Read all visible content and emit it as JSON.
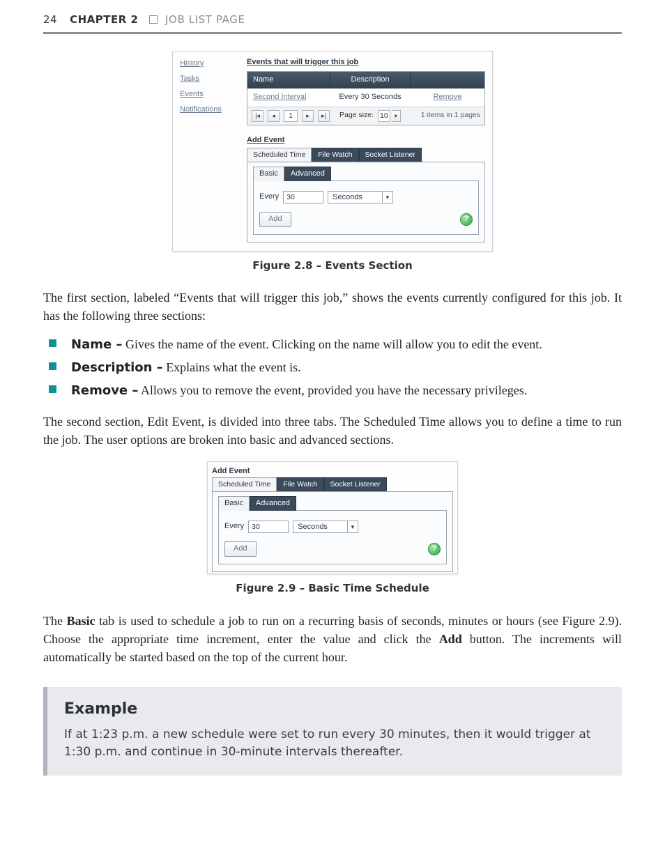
{
  "header": {
    "page_number": "24",
    "chapter_label": "CHAPTER 2",
    "section_title": "JOB LIST PAGE"
  },
  "fig28": {
    "sidebar": [
      "History",
      "Tasks",
      "Events",
      "Notifications"
    ],
    "section_title": "Events that will trigger this job",
    "cols": {
      "name": "Name",
      "desc": "Description"
    },
    "row": {
      "name": "Second Interval",
      "desc": "Every 30 Seconds",
      "remove": "Remove"
    },
    "pager": {
      "first": "|◂",
      "prev": "◂",
      "page": "1",
      "next": "▸",
      "last": "▸|",
      "size_label": "Page size:",
      "size_value": "10",
      "info": "1 items in 1 pages"
    },
    "addevent": {
      "title": "Add Event",
      "tabs": [
        "Scheduled Time",
        "File Watch",
        "Socket Listener"
      ],
      "inner_tabs": [
        "Basic",
        "Advanced"
      ],
      "every_label": "Every",
      "every_value": "30",
      "unit": "Seconds",
      "add_label": "Add"
    },
    "caption": "Figure 2.8 – Events Section"
  },
  "para1": "The first section, labeled “Events that will trigger this job,” shows the events currently configured for this job. It has the following three sections:",
  "bullets": [
    {
      "term": "Name –",
      "text": " Gives the name of the event. Clicking on the name will allow you to edit the event."
    },
    {
      "term": "Description –",
      "text": " Explains what the event is."
    },
    {
      "term": "Remove –",
      "text": " Allows you to remove the event, provided you have the necessary privileges."
    }
  ],
  "para2": "The second section, Edit Event, is divided into three tabs. The Scheduled Time allows you to define a time to run the job. The user options are broken into basic and advanced sections.",
  "fig29": {
    "title": "Add Event",
    "tabs": [
      "Scheduled Time",
      "File Watch",
      "Socket Listener"
    ],
    "inner_tabs": [
      "Basic",
      "Advanced"
    ],
    "every_label": "Every",
    "every_value": "30",
    "unit": "Seconds",
    "add_label": "Add",
    "caption": "Figure 2.9 – Basic Time Schedule"
  },
  "para3_pre": "The ",
  "para3_bold1": "Basic",
  "para3_mid": " tab is used to schedule a job to run on a recurring basis of seconds, minutes or hours (see Figure 2.9). Choose the appropriate time increment, enter the value and click the ",
  "para3_bold2": "Add",
  "para3_post": " button. The increments will automatically be started based on the top of the current hour.",
  "example": {
    "heading": "Example",
    "body": "If at 1:23 p.m. a new schedule were set to run every 30 minutes, then it would trigger at 1:30 p.m. and continue in 30-minute intervals thereafter."
  }
}
